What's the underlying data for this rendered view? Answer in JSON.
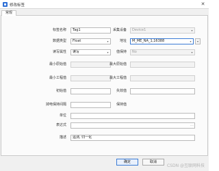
{
  "window": {
    "title": "修改标签"
  },
  "tabs": [
    {
      "label": "常规"
    }
  ],
  "form": {
    "tag_name": {
      "label": "标签名称",
      "value": "Tag1"
    },
    "collect_device": {
      "label": "采集设备",
      "value": "Device1"
    },
    "data_type": {
      "label": "数据类型",
      "value": "Float"
    },
    "address": {
      "label": "地址",
      "value": "M_ME_NA_1,16388"
    },
    "rw_attr": {
      "label": "读写属性",
      "value": "读写"
    },
    "keep": {
      "label": "值保持",
      "value": "No"
    },
    "min_raw": {
      "label": "最小原始值",
      "value": ""
    },
    "max_raw": {
      "label": "最大原始值",
      "value": ""
    },
    "min_eng": {
      "label": "最小工程值",
      "value": ""
    },
    "max_eng": {
      "label": "最大工程值",
      "value": ""
    },
    "init_val": {
      "label": "初始值",
      "value": ""
    },
    "deadband": {
      "label": "失效值",
      "value": ""
    },
    "hold_time": {
      "label": "掉电保持间隔",
      "value": ""
    },
    "hold_val": {
      "label": "保持值",
      "value": ""
    },
    "unit": {
      "label": "单位",
      "value": ""
    },
    "expression": {
      "label": "表达式",
      "value": ""
    },
    "description": {
      "label": "描述",
      "value": "遥测, 归一化"
    }
  },
  "footer": {
    "ok_label": "确定",
    "cancel_label": "取消",
    "watermark": "CSDN @互联网科技"
  }
}
